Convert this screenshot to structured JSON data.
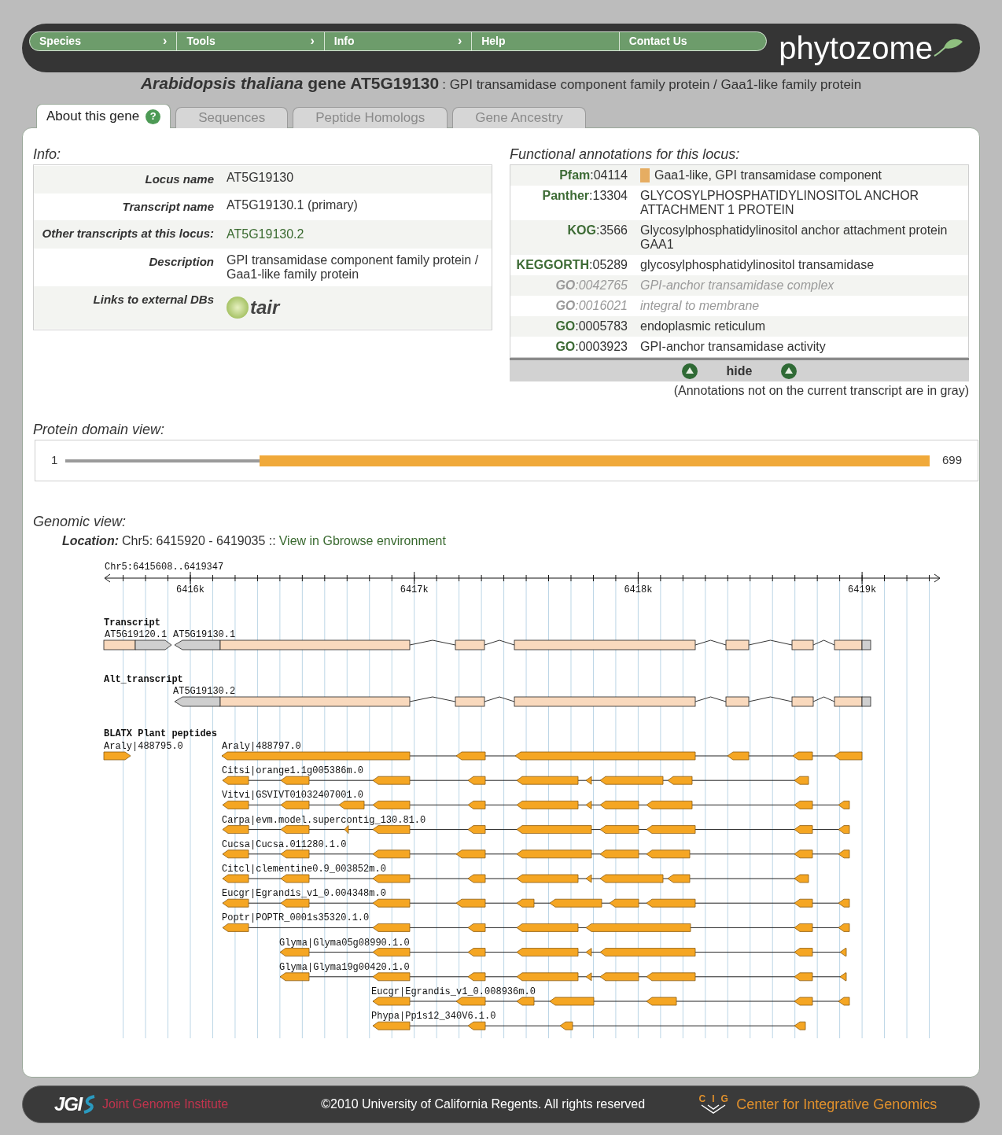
{
  "nav": {
    "menu": [
      {
        "label": "Species",
        "arrow": "›"
      },
      {
        "label": "Tools",
        "arrow": "›"
      },
      {
        "label": "Info",
        "arrow": "›"
      },
      {
        "label": "Help"
      },
      {
        "label": "Contact Us"
      }
    ],
    "logo": "phytozome"
  },
  "title": {
    "heading": "*Arabidopsis thaliana* gene AT5G19130",
    "description": ": GPI transamidase component family protein / Gaa1-like family protein"
  },
  "tabs": [
    {
      "label": "About this gene",
      "selected": true,
      "help_icon": "?"
    },
    {
      "label": "Sequences",
      "selected": false
    },
    {
      "label": "Peptide Homologs",
      "selected": false
    },
    {
      "label": "Gene Ancestry",
      "selected": false
    }
  ],
  "info": {
    "heading": "Info:",
    "rows": [
      {
        "kind": "text",
        "label": "Locus name",
        "value": "AT5G19130"
      },
      {
        "kind": "text",
        "label": "Transcript name",
        "value": "AT5G19130.1 (primary)"
      },
      {
        "kind": "link",
        "label": "Other transcripts at this locus:",
        "value": "AT5G19130.2"
      },
      {
        "kind": "text",
        "label": "Description",
        "value": "GPI transamidase component family protein / Gaa1-like family protein"
      },
      {
        "kind": "logo",
        "label": "Links to external DBs",
        "value": "tair"
      }
    ]
  },
  "annotations": {
    "heading": "Functional annotations for this locus:",
    "rows": [
      {
        "source": "Pfam",
        "id": ":04114",
        "description": "Gaa1-like, GPI transamidase component",
        "on_transcript": true,
        "swatch": true
      },
      {
        "source": "Panther",
        "id": ":13304",
        "description": "GLYCOSYLPHOSPHATIDYLINOSITOL ANCHOR ATTACHMENT 1 PROTEIN",
        "on_transcript": true,
        "swatch": false
      },
      {
        "source": "KOG",
        "id": ":3566",
        "description": "Glycosylphosphatidylinositol anchor attachment protein GAA1",
        "on_transcript": true,
        "swatch": false
      },
      {
        "source": "KEGGORTH",
        "id": ":05289",
        "description": "glycosylphosphatidylinositol transamidase",
        "on_transcript": true,
        "swatch": false
      },
      {
        "source": "GO",
        "id": ":0042765",
        "description": "GPI-anchor transamidase complex",
        "on_transcript": false,
        "swatch": false
      },
      {
        "source": "GO",
        "id": ":0016021",
        "description": "integral to membrane",
        "on_transcript": false,
        "swatch": false
      },
      {
        "source": "GO",
        "id": ":0005783",
        "description": "endoplasmic reticulum",
        "on_transcript": true,
        "swatch": false
      },
      {
        "source": "GO",
        "id": ":0003923",
        "description": "GPI-anchor transamidase activity",
        "on_transcript": true,
        "swatch": false
      }
    ],
    "hide_button": "hide",
    "note": "(Annotations not on the current transcript are in gray)"
  },
  "protein_domain": {
    "heading": "Protein domain view:",
    "start": "1",
    "end": "699"
  },
  "genomic": {
    "heading": "Genomic view:",
    "location_label": "Location:",
    "location": "Chr5: 6415920 - 6419035 ::",
    "link": "View in Gbrowse environment",
    "browser": {
      "range": "Chr5:6415608..6419347",
      "ticks": [
        "6416k",
        "6417k",
        "6418k",
        "6419k"
      ],
      "tracks": [
        {
          "kind": "transcript",
          "title": "Transcript",
          "labels": [
            "AT5G19120.1",
            "AT5G19130.1"
          ]
        },
        {
          "kind": "transcript",
          "title": "Alt_transcript",
          "labels": [
            "AT5G19130.2"
          ]
        },
        {
          "kind": "hits",
          "title": "BLATX Plant peptides",
          "hits": [
            "Araly|488795.0",
            "Araly|488797.0",
            "Citsi|orange1.1g005386m.0",
            "Vitvi|GSVIVT01032407001.0",
            "Carpa|evm.model.supercontig_130.81.0",
            "Cucsa|Cucsa.011280.1.0",
            "Citcl|clementine0.9_003852m.0",
            "Eucgr|Egrandis_v1_0.004348m.0",
            "Poptr|POPTR_0001s35320.1.0",
            "Glyma|Glyma05g08990.1.0",
            "Glyma|Glyma19g00420.1.0",
            "Eucgr|Egrandis_v1_0.008936m.0",
            "Phypa|Pp1s12_340V6.1.0"
          ]
        }
      ]
    }
  },
  "footer": {
    "left_logo": "JGI",
    "left_name": "Joint Genome Institute",
    "copyright": "©2010 University of California Regents. All rights reserved",
    "right_logo": [
      "C",
      "I",
      "G"
    ],
    "right_name": "Center for Integrative Genomics"
  }
}
